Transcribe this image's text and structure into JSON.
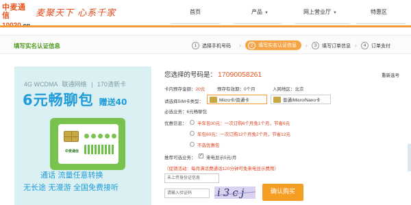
{
  "header": {
    "logo_name": "中麦通信",
    "logo_url": "10020",
    "logo_suffix": ".cn",
    "slogan": "麦聚天下 心系千家"
  },
  "nav": {
    "items": [
      {
        "label": "首页",
        "has_caret": false
      },
      {
        "label": "产品",
        "has_caret": true
      },
      {
        "label": "网上营业厅",
        "has_caret": true
      },
      {
        "label": "特惠区",
        "has_caret": false
      }
    ]
  },
  "steps": {
    "title": "填写实名认证信息",
    "items": [
      {
        "num": "1",
        "label": "选择手机号码",
        "active": false
      },
      {
        "num": "2",
        "label": "填写实名认证信息",
        "active": true
      },
      {
        "num": "3",
        "label": "填写订单信息",
        "active": false
      },
      {
        "num": "4",
        "label": "订单支付",
        "active": false
      }
    ]
  },
  "promo": {
    "network": "4G WCDMA",
    "carrier": "联通网络",
    "card_type": "170清新卡",
    "offer": "6元畅聊包",
    "gift": "赠送40",
    "sim_brand": "中麦通信",
    "line1": "通话 流量任意转换",
    "line2": "无长途 无漫游 全国免费接听"
  },
  "form": {
    "selected_label": "您选择的号码是：",
    "selected_number": "17090058261",
    "reselect": "重新选号",
    "prepaid_label": "卡内预存金额：",
    "prepaid_value": "20元",
    "validity_label": "预存有效期：",
    "validity_value": "0个月",
    "region_label": "入网地区：",
    "region_value": "北京",
    "sim_label": "请选择SIM卡类型：",
    "sim_options": [
      {
        "label": "Micro卡/普通卡",
        "selected": true
      },
      {
        "label": "普通/Micro/Nano卡",
        "selected": false
      }
    ],
    "required_label": "必选业务：",
    "required_value": "6元畅聊包",
    "offer_label": "优惠信息：",
    "offers": [
      {
        "label": "半年包30元：一次订购6个月免1个月，节省6元",
        "checked": false,
        "color": "#e5401d"
      },
      {
        "label": "年包60元：一次订购12个月免2个月，节省12元",
        "checked": false,
        "color": "#e5401d"
      },
      {
        "label": "不选优惠包",
        "checked": false,
        "color": "#e5401d"
      }
    ],
    "recommend_label": "推荐可选业务：",
    "recommend_value": "来电显示5元/月",
    "recommend_checked": true,
    "notice": "（促销活动：每月满话费通话120分钟可免来电显示费用）",
    "id_placeholder": "未上传身份证信息",
    "captcha_placeholder": "请输入验证码",
    "captcha_text": "i3cj",
    "buy_label": "确认购买"
  },
  "colors": {
    "accent_orange": "#f39a3a",
    "brand_orange": "#e9551f",
    "step_active": "#f7a447",
    "title_green": "#4d9a1e",
    "promo_blue": "#1e9bd8",
    "promo_bg": "#dbf0f3",
    "buy_button": "#f49f24",
    "warning_red": "#e5401d"
  }
}
